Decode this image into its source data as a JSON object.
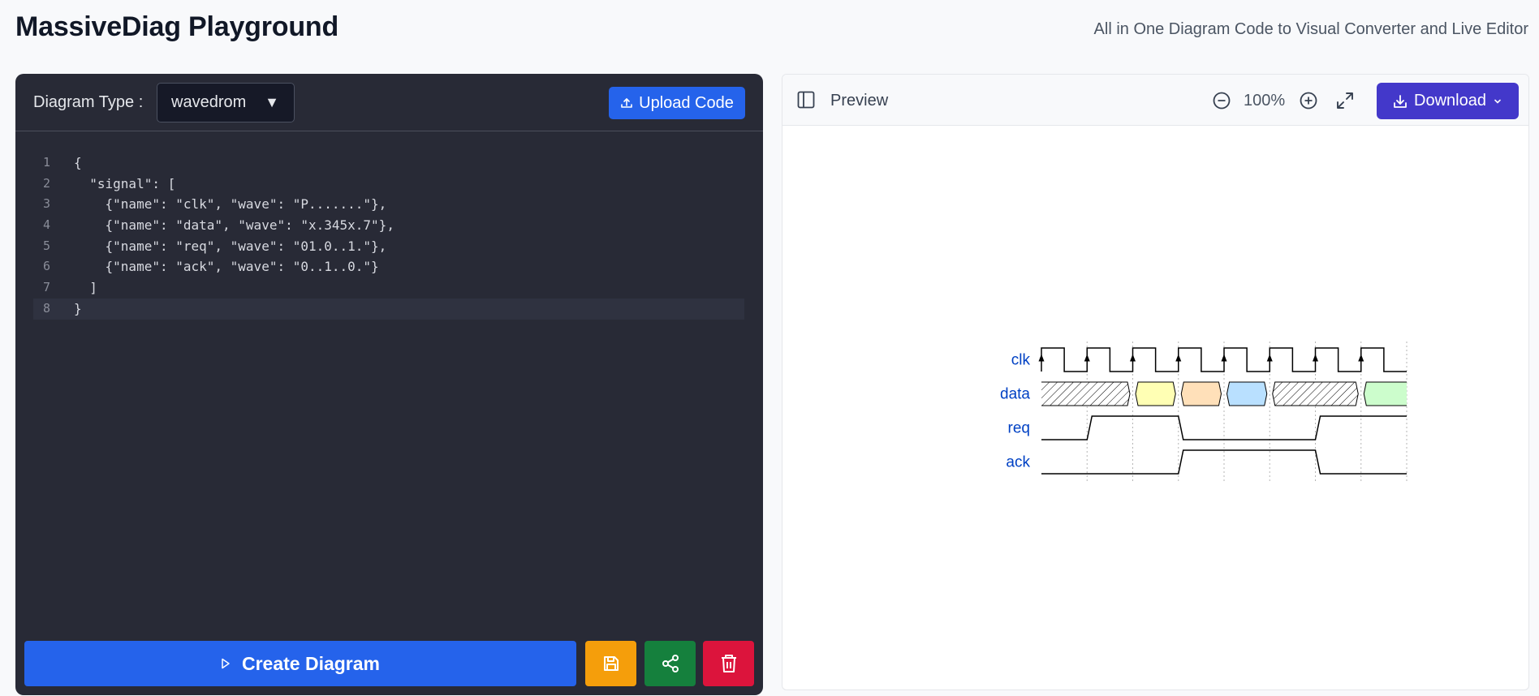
{
  "app": {
    "title": "MassiveDiag Playground",
    "subtitle": "All in One Diagram Code to Visual Converter and Live Editor"
  },
  "editor": {
    "type_label": "Diagram Type :",
    "type_value": "wavedrom",
    "upload_label": "Upload Code",
    "code_lines": [
      "{",
      "  \"signal\": [",
      "    {\"name\": \"clk\", \"wave\": \"P.......\"},",
      "    {\"name\": \"data\", \"wave\": \"x.345x.7\"},",
      "    {\"name\": \"req\", \"wave\": \"01.0..1.\"},",
      "    {\"name\": \"ack\", \"wave\": \"0..1..0.\"}",
      "  ]",
      "}"
    ],
    "line_numbers": [
      "1",
      "2",
      "3",
      "4",
      "5",
      "6",
      "7",
      "8"
    ],
    "active_line": 8,
    "create_label": "Create Diagram"
  },
  "preview": {
    "label": "Preview",
    "zoom": "100%",
    "download_label": "Download"
  },
  "diagram": {
    "signals": [
      {
        "name": "clk",
        "wave": "P......."
      },
      {
        "name": "data",
        "wave": "x.345x.7"
      },
      {
        "name": "req",
        "wave": "01.0..1."
      },
      {
        "name": "ack",
        "wave": "0..1..0."
      }
    ],
    "colors": {
      "label": "#0041c4",
      "3": "#ffffb4",
      "4": "#ffe0b9",
      "5": "#b9e0ff",
      "7": "#ccfdcc",
      "gridline": "#b5b5b5"
    }
  },
  "colors": {
    "editor_bg": "#282a36",
    "primary": "#2563eb",
    "save": "#f59e0b",
    "share": "#15803d",
    "delete": "#dc143c",
    "download": "#4338ca"
  }
}
